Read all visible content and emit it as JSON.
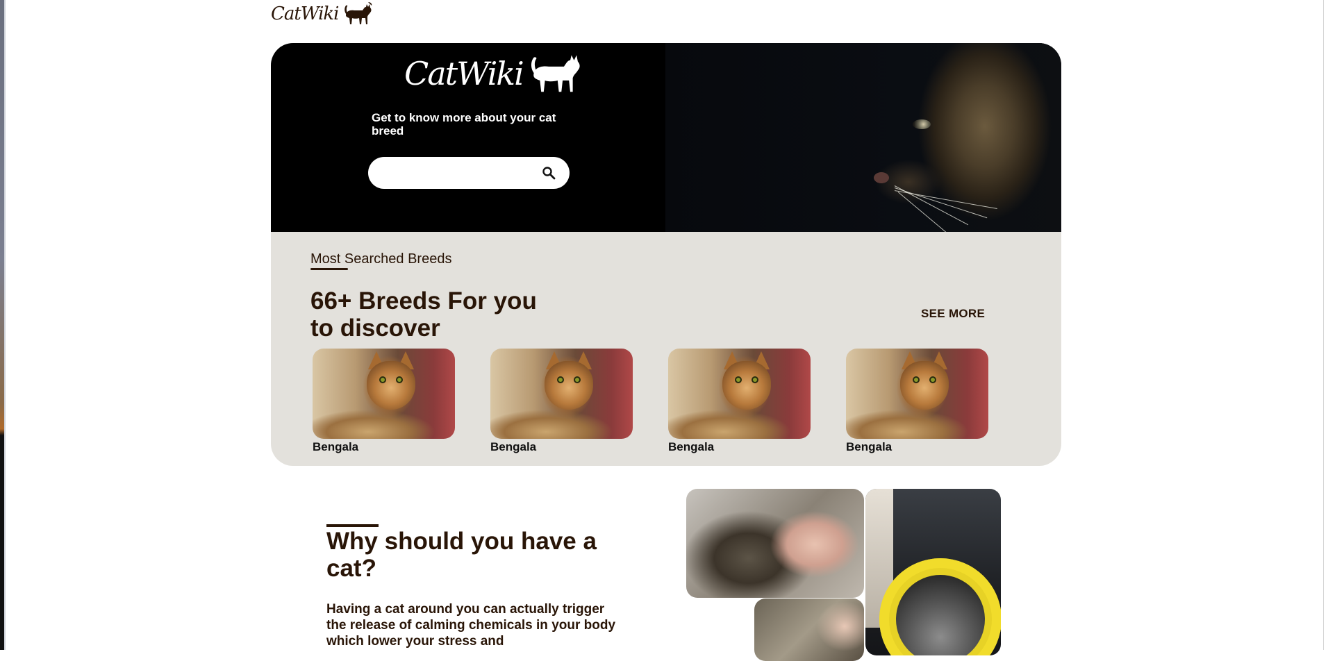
{
  "header": {
    "logo_text": "CatWiki"
  },
  "hero": {
    "logo_text": "CatWiki",
    "tagline": "Get to know more about your cat breed",
    "search": {
      "value": "",
      "placeholder": ""
    }
  },
  "breeds": {
    "section_label": "Most Searched Breeds",
    "heading": "66+ Breeds For you to discover",
    "see_more_label": "SEE MORE",
    "cards": [
      {
        "name": "Bengala"
      },
      {
        "name": "Bengala"
      },
      {
        "name": "Bengala"
      },
      {
        "name": "Bengala"
      }
    ]
  },
  "why": {
    "heading": "Why should you have a cat?",
    "text": "Having a cat around you can actually trigger the release of calming chemicals in your body which lower your stress and"
  },
  "colors": {
    "brand_dark": "#291507",
    "section_bg": "#e3e1dc",
    "hero_bg": "#000000"
  },
  "icons": {
    "search": "search-icon",
    "logo_cat": "cat-silhouette-icon"
  }
}
